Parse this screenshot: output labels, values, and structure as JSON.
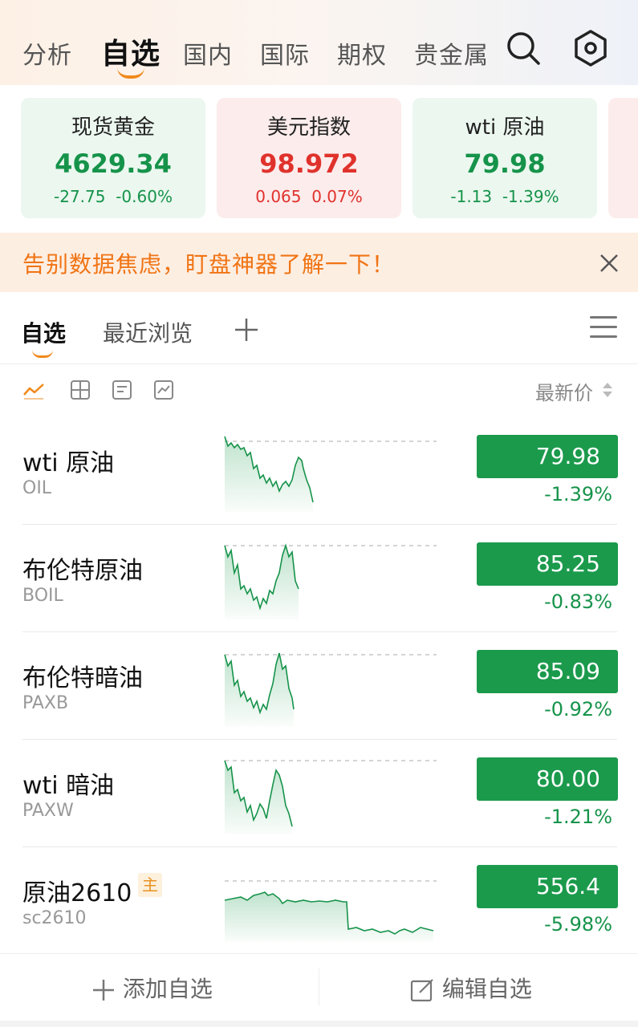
{
  "nav": {
    "tabs": [
      "分析",
      "自选",
      "国内",
      "国际",
      "期权",
      "贵金属"
    ],
    "active_index": 1,
    "icons": [
      "search-icon",
      "settings-icon"
    ]
  },
  "cards": [
    {
      "name": "现货黄金",
      "value": "4629.34",
      "change": "-27.75",
      "pct": "-0.60%",
      "trend": "down"
    },
    {
      "name": "美元指数",
      "value": "98.972",
      "change": "0.065",
      "pct": "0.07%",
      "trend": "up"
    },
    {
      "name": "wti 原油",
      "value": "79.98",
      "change": "-1.13",
      "pct": "-1.39%",
      "trend": "down"
    }
  ],
  "banner": {
    "text": "告别数据焦虑，盯盘神器了解一下！",
    "close_icon": "close-icon"
  },
  "subtabs": {
    "items": [
      "自选",
      "最近浏览"
    ],
    "add_icon": "plus-icon",
    "menu_icon": "menu-icon"
  },
  "view": {
    "icons": [
      "line-view-icon",
      "grid-view-icon",
      "card-view-icon",
      "chart-view-icon"
    ],
    "sort_label": "最新价"
  },
  "watchlist": [
    {
      "name": "wti 原油",
      "code": "OIL",
      "price": "79.98",
      "pct": "-1.39%",
      "main": ""
    },
    {
      "name": "布伦特原油",
      "code": "BOIL",
      "price": "85.25",
      "pct": "-0.83%",
      "main": ""
    },
    {
      "name": "布伦特暗油",
      "code": "PAXB",
      "price": "85.09",
      "pct": "-0.92%",
      "main": ""
    },
    {
      "name": "wti 暗油",
      "code": "PAXW",
      "price": "80.00",
      "pct": "-1.21%",
      "main": ""
    },
    {
      "name": "原油2610",
      "code": "sc2610",
      "price": "556.4",
      "pct": "-5.98%",
      "main": "主"
    }
  ],
  "footer": {
    "add_label": "添加自选",
    "edit_label": "编辑自选"
  },
  "colors": {
    "up": "#e0322c",
    "down": "#16934a",
    "accent": "#f08a1c",
    "price_bg": "#1b9a4c"
  }
}
